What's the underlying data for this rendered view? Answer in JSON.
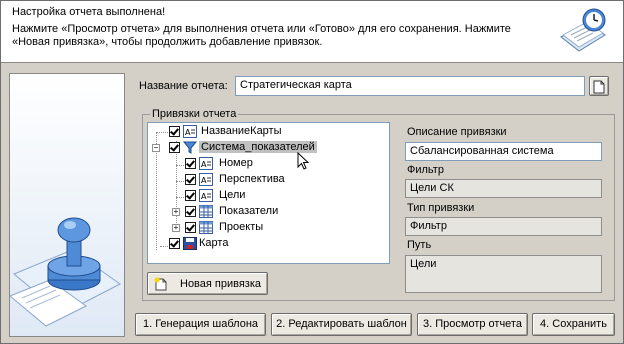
{
  "header": {
    "title": "Настройка отчета выполнена!",
    "text": "Нажмите «Просмотр отчета»  для выполнения отчета или «Готово» для его сохранения. Нажмите «Новая привязка», чтобы продолжить добавление привязок."
  },
  "report": {
    "name_label": "Название отчета:",
    "name_value": "Стратегическая карта"
  },
  "bindings": {
    "group_title": "Привязки отчета",
    "tree": [
      {
        "label": "НазваниеКарты",
        "icon": "text-field-icon"
      },
      {
        "label": "Система_показателей",
        "icon": "filter-icon",
        "selected": true
      },
      {
        "label": "Номер",
        "icon": "text-field-icon"
      },
      {
        "label": "Перспектива",
        "icon": "text-field-icon"
      },
      {
        "label": "Цели",
        "icon": "text-field-icon"
      },
      {
        "label": "Показатели",
        "icon": "table-icon"
      },
      {
        "label": "Проекты",
        "icon": "table-icon"
      },
      {
        "label": "Карта",
        "icon": "save-disk-icon"
      }
    ],
    "new_binding_label": "Новая привязка"
  },
  "details": {
    "description_label": "Описание привязки",
    "description_value": "Сбалансированная система",
    "filter_label": "Фильтр",
    "filter_value": "Цели СК",
    "type_label": "Тип привязки",
    "type_value": "Фильтр",
    "path_label": "Путь",
    "path_value": "Цели"
  },
  "footer": {
    "btn1": "1. Генерация шаблона",
    "btn2": "2. Редактировать шаблон",
    "btn3": "3. Просмотр отчета",
    "btn4": "4. Сохранить"
  },
  "colors": {
    "accent": "#2d6bc4",
    "header_bg": "#ffffff",
    "window_bg": "#d4d0c8"
  }
}
